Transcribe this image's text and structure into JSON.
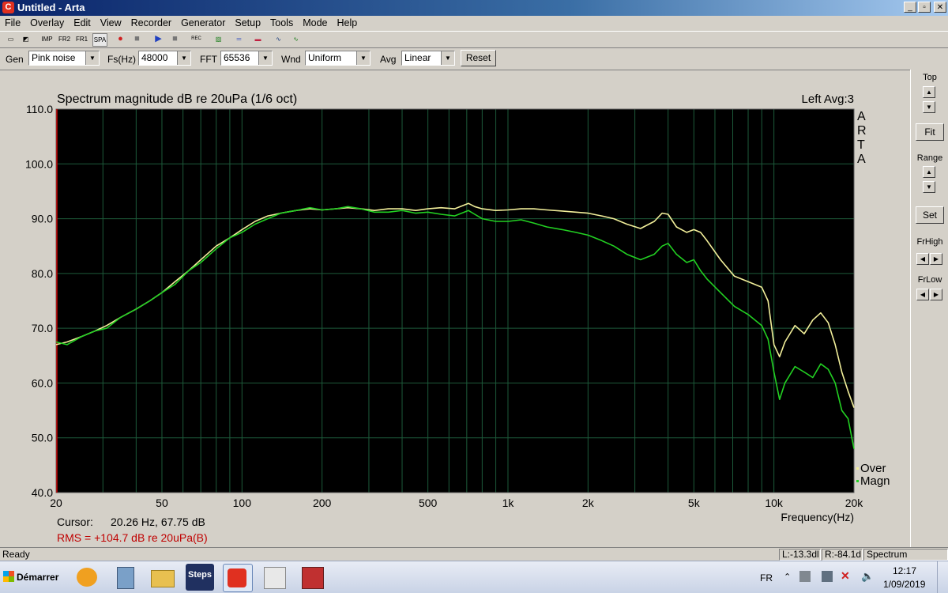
{
  "window": {
    "title": "Untitled - Arta",
    "app_icon": "C",
    "controls": [
      "_",
      "▫",
      "✕"
    ]
  },
  "menu": [
    "File",
    "Overlay",
    "Edit",
    "View",
    "Recorder",
    "Generator",
    "Setup",
    "Tools",
    "Mode",
    "Help"
  ],
  "toolbar_icons": [
    {
      "name": "new-icon",
      "glyph": "▭"
    },
    {
      "name": "open-icon",
      "glyph": "◩"
    },
    {
      "name": "imp-mode-icon",
      "glyph": "IMP"
    },
    {
      "name": "fr2-mode-icon",
      "glyph": "FR2"
    },
    {
      "name": "fr1-mode-icon",
      "glyph": "FR1"
    },
    {
      "name": "spa-mode-icon",
      "glyph": "SPA"
    },
    {
      "name": "record-icon",
      "glyph": "●"
    },
    {
      "name": "stop-icon",
      "glyph": "■"
    },
    {
      "name": "play-icon",
      "glyph": "▶"
    },
    {
      "name": "stop2-icon",
      "glyph": "■"
    },
    {
      "name": "rec-setup-icon",
      "glyph": "REC"
    },
    {
      "name": "gen-icon",
      "glyph": "▨"
    },
    {
      "name": "probe-icon",
      "glyph": "═"
    },
    {
      "name": "overlay-icon",
      "glyph": "▬"
    },
    {
      "name": "scope-icon",
      "glyph": "∿"
    },
    {
      "name": "meter-icon",
      "glyph": "∿"
    }
  ],
  "controls": {
    "gen_label": "Gen",
    "gen_value": "Pink noise",
    "fs_label": "Fs(Hz)",
    "fs_value": "48000",
    "fft_label": "FFT",
    "fft_value": "65536",
    "wnd_label": "Wnd",
    "wnd_value": "Uniform",
    "avg_label": "Avg",
    "avg_value": "Linear",
    "reset_label": "Reset"
  },
  "right_panel": {
    "top_label": "Top",
    "fit_label": "Fit",
    "range_label": "Range",
    "set_label": "Set",
    "frhigh_label": "FrHigh",
    "frlow_label": "FrLow"
  },
  "chart_data": {
    "type": "line",
    "title": "Spectrum magnitude dB re 20uPa (1/6 oct)",
    "right_info": "Left  Avg:3",
    "watermark": "ARTA",
    "xlabel": "Frequency(Hz)",
    "xscale": "log",
    "xlim": [
      20,
      20000
    ],
    "ylim": [
      40,
      110
    ],
    "x_ticks": [
      "20",
      "50",
      "100",
      "200",
      "500",
      "1k",
      "2k",
      "5k",
      "10k",
      "20k"
    ],
    "y_ticks": [
      "110.0",
      "100.0",
      "90.0",
      "80.0",
      "70.0",
      "60.0",
      "50.0",
      "40.0"
    ],
    "grid": true,
    "legend_position": "bottom-right",
    "series": [
      {
        "name": "Over",
        "color": "#f2ef9a",
        "x": [
          20,
          22,
          25,
          28,
          31,
          35,
          40,
          45,
          50,
          56,
          63,
          70,
          80,
          90,
          100,
          112,
          125,
          140,
          160,
          180,
          200,
          225,
          250,
          280,
          315,
          355,
          400,
          450,
          500,
          560,
          630,
          710,
          750,
          800,
          900,
          1000,
          1120,
          1250,
          1400,
          1600,
          1800,
          2000,
          2250,
          2500,
          2800,
          3150,
          3550,
          3800,
          4000,
          4300,
          4700,
          5000,
          5300,
          5600,
          6300,
          7100,
          8000,
          9000,
          9500,
          10000,
          10500,
          11000,
          12000,
          13000,
          14000,
          15000,
          16000,
          17000,
          18000,
          19000,
          20000
        ],
        "y": [
          67.0,
          67.5,
          68.5,
          69.5,
          70.5,
          72.0,
          73.5,
          75.0,
          76.5,
          78.5,
          80.5,
          82.5,
          85.0,
          86.5,
          88.0,
          89.5,
          90.5,
          91.0,
          91.5,
          91.8,
          91.6,
          91.8,
          92.0,
          91.8,
          91.5,
          91.8,
          91.8,
          91.5,
          91.8,
          92.0,
          91.8,
          92.8,
          92.2,
          91.8,
          91.5,
          91.6,
          91.8,
          91.8,
          91.6,
          91.4,
          91.2,
          91.0,
          90.5,
          90.0,
          89.0,
          88.2,
          89.5,
          91.0,
          90.8,
          88.5,
          87.5,
          88.0,
          87.5,
          86.0,
          82.5,
          79.5,
          78.5,
          77.5,
          75.0,
          67.0,
          64.8,
          67.5,
          70.5,
          69.0,
          71.5,
          72.8,
          71.0,
          67.0,
          62.0,
          58.5,
          55.5
        ]
      },
      {
        "name": "Magn",
        "color": "#22d022",
        "x": [
          20,
          22,
          25,
          28,
          31,
          35,
          40,
          45,
          50,
          56,
          63,
          70,
          80,
          90,
          100,
          112,
          125,
          140,
          160,
          180,
          200,
          225,
          250,
          280,
          315,
          355,
          400,
          450,
          500,
          560,
          630,
          710,
          750,
          800,
          900,
          1000,
          1120,
          1250,
          1400,
          1600,
          1800,
          2000,
          2250,
          2500,
          2800,
          3150,
          3550,
          3800,
          4000,
          4300,
          4700,
          5000,
          5300,
          5600,
          6300,
          7100,
          8000,
          9000,
          9500,
          10000,
          10500,
          11000,
          12000,
          13000,
          14000,
          15000,
          16000,
          17000,
          18000,
          19000,
          20000
        ],
        "y": [
          67.5,
          67.0,
          68.5,
          69.5,
          70.0,
          72.0,
          73.5,
          75.0,
          76.5,
          78.0,
          80.5,
          82.0,
          84.5,
          86.5,
          87.5,
          89.0,
          90.0,
          91.0,
          91.5,
          92.0,
          91.6,
          91.8,
          92.2,
          91.8,
          91.2,
          91.2,
          91.5,
          91.0,
          91.2,
          90.8,
          90.5,
          91.5,
          90.8,
          90.0,
          89.5,
          89.5,
          89.8,
          89.2,
          88.5,
          88.0,
          87.5,
          87.0,
          86.0,
          85.0,
          83.5,
          82.5,
          83.5,
          85.0,
          85.5,
          83.5,
          82.0,
          82.5,
          80.5,
          79.0,
          76.5,
          74.0,
          72.5,
          70.5,
          68.0,
          62.0,
          57.0,
          60.0,
          63.0,
          62.0,
          61.0,
          63.5,
          62.5,
          60.0,
          55.0,
          53.5,
          48.0
        ]
      }
    ]
  },
  "cursor": {
    "label": "Cursor:",
    "readout": "20.26 Hz, 67.75 dB"
  },
  "rms_text": "RMS = +104.7 dB re 20uPa(B)",
  "status": {
    "ready": "Ready",
    "left_level": "L:-13.3dl",
    "right_level": "R:-84.1d",
    "mode": "Spectrum Analyzer"
  },
  "taskbar": {
    "start_label": "Démarrer",
    "apps": [
      {
        "name": "media-player-icon",
        "color": "#f0a020"
      },
      {
        "name": "calculator-icon",
        "color": "#7aa0c8"
      },
      {
        "name": "explorer-icon",
        "color": "#e8c050"
      },
      {
        "name": "steps-app-icon",
        "color": "#203060",
        "label": "Steps"
      },
      {
        "name": "arta-app-icon",
        "color": "#e03020"
      },
      {
        "name": "limp-app-icon",
        "color": "#e8e8e8"
      },
      {
        "name": "calibration-app-icon",
        "color": "#c03030"
      }
    ],
    "lang": "FR",
    "time": "12:17",
    "date": "1/09/2019"
  },
  "colors": {
    "plot_background": "#000000",
    "grid": "#1d5a3a",
    "axis_text": "#000000",
    "rms_text": "#c00000"
  }
}
